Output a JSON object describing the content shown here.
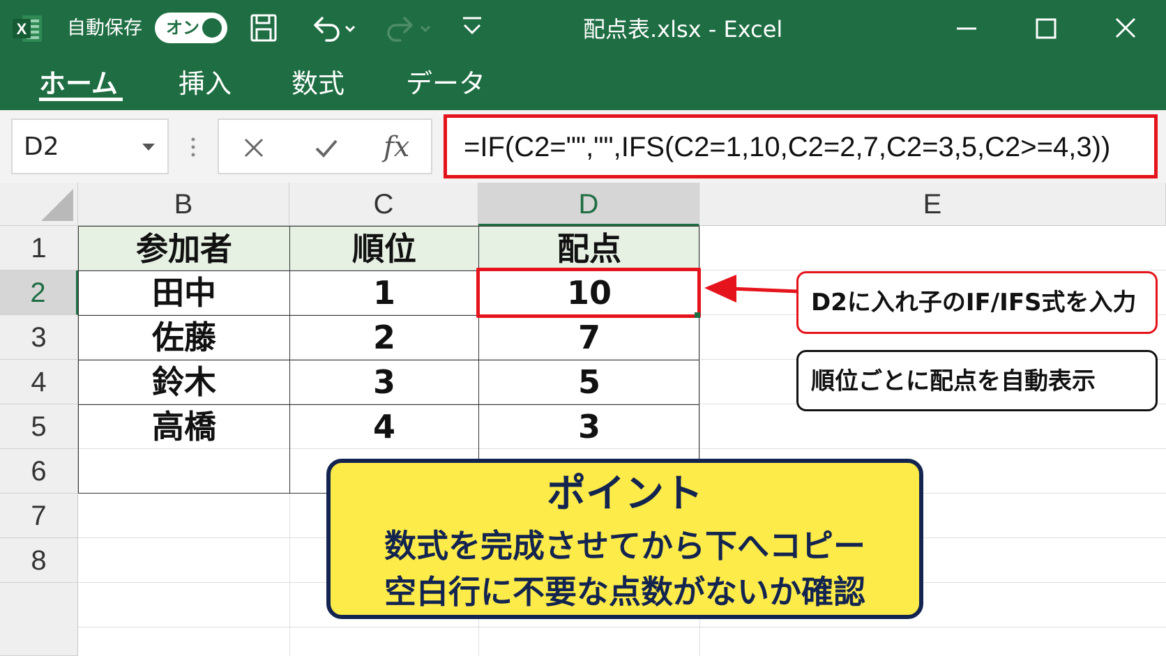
{
  "titlebar": {
    "app_icon_letter": "X",
    "autosave_label": "自動保存",
    "autosave_state": "オン",
    "document_title": "配点表.xlsx  -  Excel",
    "icons": [
      "save-icon",
      "undo-icon",
      "redo-icon",
      "customize-qat-icon",
      "minimize-icon",
      "maximize-icon",
      "close-icon"
    ]
  },
  "ribbon": {
    "tabs": [
      {
        "label": "ホーム",
        "active": true
      },
      {
        "label": "挿入",
        "active": false
      },
      {
        "label": "数式",
        "active": false
      },
      {
        "label": "データ",
        "active": false
      }
    ]
  },
  "formula_bar": {
    "name_box": "D2",
    "cancel_icon": "×",
    "enter_icon": "✓",
    "fx_label": "fx",
    "formula": "=IF(C2=\"\",\"\",IFS(C2=1,10,C2=2,7,C2=3,5,C2>=4,3))"
  },
  "sheet": {
    "columns": [
      "B",
      "C",
      "D",
      "E"
    ],
    "selected_column": "D",
    "rows": [
      "1",
      "2",
      "3",
      "4",
      "5",
      "6",
      "7",
      "8"
    ],
    "selected_row": "2",
    "header_fill": "#e6f0e3",
    "table": {
      "headers": [
        "参加者",
        "順位",
        "配点"
      ],
      "data": [
        [
          "田中",
          "1",
          "10"
        ],
        [
          "佐藤",
          "2",
          "7"
        ],
        [
          "鈴木",
          "3",
          "5"
        ],
        [
          "高橋",
          "4",
          "3"
        ]
      ]
    }
  },
  "annotations": {
    "callout_1": "D2に入れ子のIF/IFS式を入力",
    "callout_2": "順位ごとに配点を自動表示",
    "point_title": "ポイント",
    "point_line1": "数式を完成させてから下へコピー",
    "point_line2": "空白行に不要な点数がないか確認"
  },
  "colors": {
    "excel_green": "#1f6e43",
    "highlight_red": "#e5131b",
    "point_yellow": "#fdeb4a",
    "point_navy": "#12244f"
  }
}
